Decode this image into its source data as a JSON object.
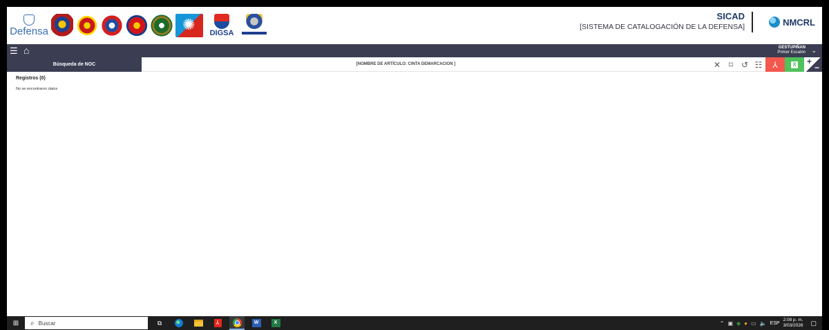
{
  "header": {
    "brand": "Defensa",
    "digsa_text": "DIGSA",
    "sicad_title": "SICAD",
    "sicad_subtitle": "[SISTEMA DE CATALOGACIÓN DE LA DEFENSA]",
    "nmcrl_label": "NMCRL"
  },
  "navbar": {
    "menu_icon": "hamburger-icon",
    "home_icon": "home-icon",
    "user_name": "GESTUPIÑAN",
    "user_role": "Primer Escalón"
  },
  "search": {
    "tab_label": "Búsqueda de NOC",
    "query_text": "[NOMBRE DE ARTÍCULO: CINTA DEMARCACION ]",
    "tools": [
      "close-icon",
      "bookmark-icon",
      "history-icon",
      "list-icon",
      "pdf-icon",
      "excel-icon",
      "plus-minus-icon"
    ],
    "pdf_color": "#f4574d",
    "excel_color": "#4fc25c"
  },
  "results": {
    "records_label": "Registros (0)",
    "no_data": "No se encontraron datos"
  },
  "taskbar": {
    "search_placeholder": "Buscar",
    "language": "ESP",
    "time": "2:08 p. m.",
    "date": "3/03/2026"
  },
  "colors": {
    "nav_bg": "#3b3d52",
    "accent_blue": "#3a6fb3"
  }
}
